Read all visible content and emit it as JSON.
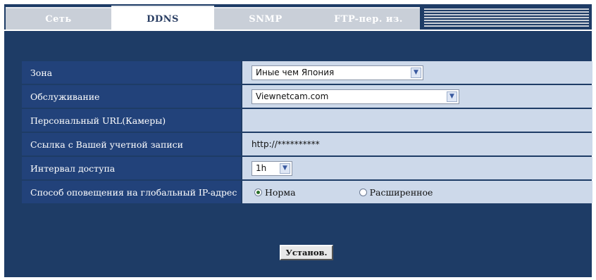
{
  "tabs": [
    {
      "label": "Сеть",
      "active": false
    },
    {
      "label": "DDNS",
      "active": true
    },
    {
      "label": "SNMP",
      "active": false
    },
    {
      "label": "FTP-пер. из.",
      "active": false
    }
  ],
  "rows": {
    "zone": {
      "label": "Зона",
      "value": "Иные чем Япония"
    },
    "service": {
      "label": "Обслуживание",
      "value": "Viewnetcam.com"
    },
    "personal_url": {
      "label": "Персональный URL(Камеры)",
      "value": ""
    },
    "account_link": {
      "label": "Ссылка с Вашей учетной записи",
      "value": "http://**********"
    },
    "access_interval": {
      "label": "Интервал доступа",
      "value": "1h"
    },
    "notify_method": {
      "label": "Способ оповещения на глобальный IP-адрес",
      "options": [
        "Норма",
        "Расширенное"
      ],
      "selected": "Норма"
    }
  },
  "set_button": "Установ.",
  "colors": {
    "background": "#1e3c66",
    "label_cell": "#22427a",
    "value_cell": "#cdd9ea",
    "tab_inactive": "#c9cfd8"
  }
}
